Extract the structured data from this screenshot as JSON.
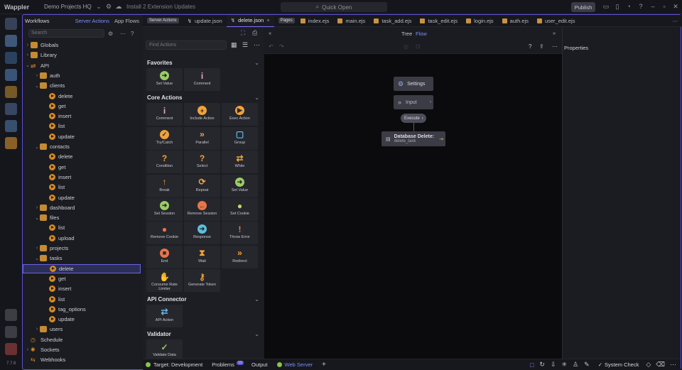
{
  "titlebar": {
    "app_name": "Wappler",
    "project": "Demo Projects HQ",
    "updates_label": "Install 2 Extension Updates",
    "quick_open": "Quick Open",
    "publish": "Publish"
  },
  "workflows": {
    "title": "Workflows",
    "tab_server_actions": "Server Actions",
    "tab_app_flows": "App Flows",
    "search_placeholder": "Search",
    "tree": [
      {
        "label": "Globals",
        "kind": "folder",
        "depth": 0,
        "expanded": false
      },
      {
        "label": "Library",
        "kind": "folder",
        "depth": 0,
        "expanded": false
      },
      {
        "label": "API",
        "kind": "api",
        "depth": 0,
        "expanded": true
      },
      {
        "label": "auth",
        "kind": "folder",
        "depth": 1,
        "expanded": false
      },
      {
        "label": "clients",
        "kind": "folder",
        "depth": 1,
        "expanded": true
      },
      {
        "label": "delete",
        "kind": "action",
        "depth": 2
      },
      {
        "label": "get",
        "kind": "action",
        "depth": 2
      },
      {
        "label": "insert",
        "kind": "action",
        "depth": 2
      },
      {
        "label": "list",
        "kind": "action",
        "depth": 2
      },
      {
        "label": "update",
        "kind": "action",
        "depth": 2
      },
      {
        "label": "contacts",
        "kind": "folder",
        "depth": 1,
        "expanded": true
      },
      {
        "label": "delete",
        "kind": "action",
        "depth": 2
      },
      {
        "label": "get",
        "kind": "action",
        "depth": 2
      },
      {
        "label": "insert",
        "kind": "action",
        "depth": 2
      },
      {
        "label": "list",
        "kind": "action",
        "depth": 2
      },
      {
        "label": "update",
        "kind": "action",
        "depth": 2
      },
      {
        "label": "dashboard",
        "kind": "folder",
        "depth": 1,
        "expanded": false
      },
      {
        "label": "files",
        "kind": "folder",
        "depth": 1,
        "expanded": true
      },
      {
        "label": "list",
        "kind": "action",
        "depth": 2
      },
      {
        "label": "upload",
        "kind": "action",
        "depth": 2
      },
      {
        "label": "projects",
        "kind": "folder",
        "depth": 1,
        "expanded": false
      },
      {
        "label": "tasks",
        "kind": "folder",
        "depth": 1,
        "expanded": true
      },
      {
        "label": "delete",
        "kind": "action",
        "depth": 2,
        "selected": true
      },
      {
        "label": "get",
        "kind": "action",
        "depth": 2
      },
      {
        "label": "insert",
        "kind": "action",
        "depth": 2
      },
      {
        "label": "list",
        "kind": "action",
        "depth": 2
      },
      {
        "label": "tag_options",
        "kind": "action",
        "depth": 2
      },
      {
        "label": "update",
        "kind": "action",
        "depth": 2
      },
      {
        "label": "users",
        "kind": "folder",
        "depth": 1,
        "expanded": false
      },
      {
        "label": "Schedule",
        "kind": "schedule",
        "depth": 0
      },
      {
        "label": "Sockets",
        "kind": "sockets",
        "depth": 0,
        "expanded": false
      },
      {
        "label": "Webhooks",
        "kind": "webhooks",
        "depth": 0
      }
    ]
  },
  "tabs": {
    "server_actions_pill": "Server Actions",
    "server_tabs": [
      "update.json",
      "delete.json"
    ],
    "pages_pill": "Pages",
    "page_tabs": [
      "index.ejs",
      "main.ejs",
      "task_add.ejs",
      "task_edit.ejs",
      "login.ejs",
      "auth.ejs",
      "user_edit.ejs"
    ]
  },
  "palette": {
    "search_placeholder": "Find Actions",
    "sections": [
      {
        "title": "Favorites",
        "items": [
          {
            "label": "Set Value",
            "icon": "arrow-right-circle",
            "glyph": "➜",
            "color": "#9ccc65",
            "circle": true
          },
          {
            "label": "Comment",
            "icon": "info",
            "glyph": "i",
            "color": "#e6a3d0"
          }
        ]
      },
      {
        "title": "Core Actions",
        "items": [
          {
            "label": "Comment",
            "icon": "info",
            "glyph": "i",
            "color": "#e6a3d0"
          },
          {
            "label": "Include Action",
            "icon": "plus-circle",
            "glyph": "+",
            "color": "#f1a23a",
            "circle": true
          },
          {
            "label": "Exec Action",
            "icon": "play-circle",
            "glyph": "▶",
            "color": "#f1a23a",
            "circle": true
          },
          {
            "label": "Try/Catch",
            "icon": "check-circle",
            "glyph": "✓",
            "color": "#f1a23a",
            "circle": true
          },
          {
            "label": "Parallel",
            "icon": "double-chevron",
            "glyph": "»",
            "color": "#f1a23a"
          },
          {
            "label": "Group",
            "icon": "group-box",
            "glyph": "▢",
            "color": "#62b5e5"
          },
          {
            "label": "Condition",
            "icon": "question",
            "glyph": "?",
            "color": "#f1a23a"
          },
          {
            "label": "Select",
            "icon": "question",
            "glyph": "?",
            "color": "#f1a23a"
          },
          {
            "label": "While",
            "icon": "loop",
            "glyph": "⇄",
            "color": "#f1a23a"
          },
          {
            "label": "Break",
            "icon": "arrow-up",
            "glyph": "↑",
            "color": "#f1a23a"
          },
          {
            "label": "Repeat",
            "icon": "repeat",
            "glyph": "⟳",
            "color": "#f1a23a"
          },
          {
            "label": "Set Value",
            "icon": "arrow-right-circle",
            "glyph": "➜",
            "color": "#9ccc65",
            "circle": true
          },
          {
            "label": "Set Session",
            "icon": "arrow-right-circle",
            "glyph": "➜",
            "color": "#9ccc65",
            "circle": true
          },
          {
            "label": "Remove Session",
            "icon": "arrow-left-circle",
            "glyph": "←",
            "color": "#e8754a",
            "circle": true
          },
          {
            "label": "Set Cookie",
            "icon": "cookie",
            "glyph": "●",
            "color": "#c7d36a"
          },
          {
            "label": "Remove Cookie",
            "icon": "cookie",
            "glyph": "●",
            "color": "#e8754a"
          },
          {
            "label": "Response",
            "icon": "arrow-right-circle",
            "glyph": "➜",
            "color": "#5bc0de",
            "circle": true
          },
          {
            "label": "Throw Error",
            "icon": "warning",
            "glyph": "!",
            "color": "#e8754a"
          },
          {
            "label": "End",
            "icon": "stop-circle",
            "glyph": "■",
            "color": "#e8754a",
            "circle": true
          },
          {
            "label": "Wait",
            "icon": "hourglass",
            "glyph": "⧗",
            "color": "#f1a23a"
          },
          {
            "label": "Redirect",
            "icon": "double-chevron",
            "glyph": "»",
            "color": "#f1a23a"
          },
          {
            "label": "Consume Rate Limiter",
            "icon": "hand",
            "glyph": "✋",
            "color": "#f1a23a"
          },
          {
            "label": "Generate Token",
            "icon": "key",
            "glyph": "⚷",
            "color": "#f1a23a"
          }
        ]
      },
      {
        "title": "API Connector",
        "items": [
          {
            "label": "API Action",
            "icon": "arrows-exchange",
            "glyph": "⇄",
            "color": "#62b5e5"
          }
        ]
      },
      {
        "title": "Validator",
        "items": [
          {
            "label": "Validate Data",
            "icon": "check",
            "glyph": "✓",
            "color": "#9ccc65"
          }
        ]
      }
    ]
  },
  "flow": {
    "tab_tree": "Tree",
    "tab_flow": "Flow",
    "nodes": {
      "settings": "Settings",
      "input": "Input",
      "execute": "Execute",
      "db_title": "Database Delete:",
      "db_sub": "delete_task"
    }
  },
  "properties": {
    "title": "Properties"
  },
  "status": {
    "target": "Target: Development",
    "problems": "Problems",
    "problems_count": "10",
    "output": "Output",
    "web_server": "Web Server",
    "system_check": "System Check"
  },
  "version": "7.7.6",
  "colors": {
    "accent": "#7b70ff",
    "folder": "#c48b33",
    "action": "#d58a28"
  }
}
